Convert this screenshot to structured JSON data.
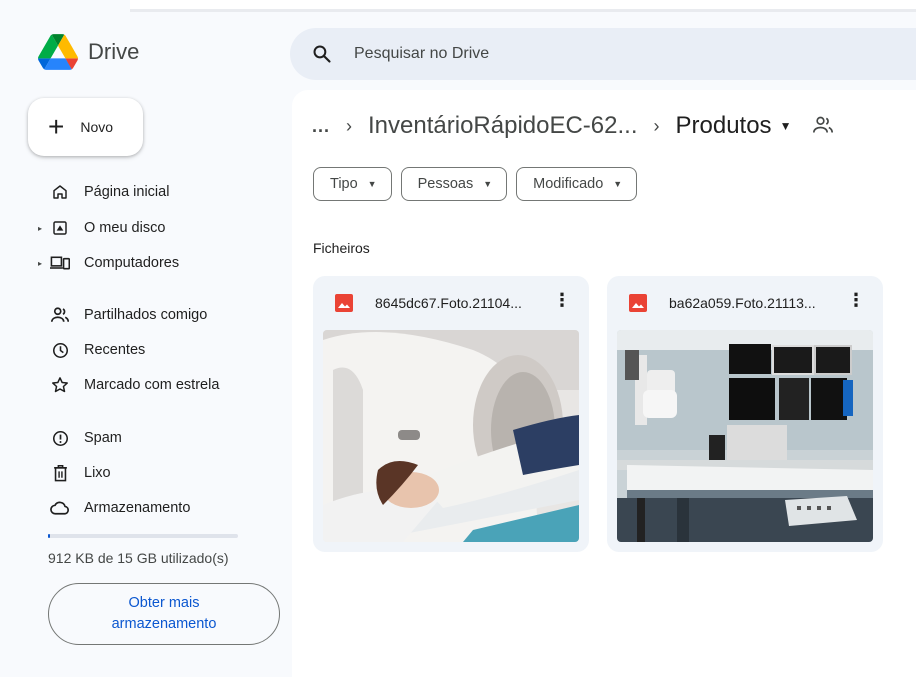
{
  "app": {
    "name": "Drive",
    "colors": {
      "accent": "#0b57d0",
      "background": "#f8fafd",
      "search_bg": "#e9eef6",
      "card_bg": "#f0f4f9",
      "pdf_red": "#ea4335"
    }
  },
  "sidebar": {
    "new_button": {
      "icon": "plus-icon",
      "label": "Novo"
    },
    "items": [
      {
        "label": "Página inicial",
        "icon": "home-icon",
        "expandable": false
      },
      {
        "label": "O meu disco",
        "icon": "my-drive-icon",
        "expandable": true
      },
      {
        "label": "Computadores",
        "icon": "computers-icon",
        "expandable": true
      },
      {
        "label": "Partilhados comigo",
        "icon": "shared-icon",
        "expandable": false
      },
      {
        "label": "Recentes",
        "icon": "clock-icon",
        "expandable": false
      },
      {
        "label": "Marcado com estrela",
        "icon": "star-icon",
        "expandable": false
      },
      {
        "label": "Spam",
        "icon": "spam-icon",
        "expandable": false
      },
      {
        "label": "Lixo",
        "icon": "trash-icon",
        "expandable": false
      },
      {
        "label": "Armazenamento",
        "icon": "cloud-icon",
        "expandable": false
      }
    ],
    "storage": {
      "used_text": "912 KB de 15 GB utilizado(s)",
      "used_fraction": 0.0001,
      "button_label": "Obter mais armazenamento"
    }
  },
  "search": {
    "placeholder": "Pesquisar no Drive",
    "icon": "search-icon"
  },
  "breadcrumb": {
    "more": "...",
    "separator": "›",
    "parent": "InventárioRápidoEC-62...",
    "current": "Produtos"
  },
  "filters": [
    {
      "label": "Tipo"
    },
    {
      "label": "Pessoas"
    },
    {
      "label": "Modificado"
    }
  ],
  "section": {
    "title": "Ficheiros"
  },
  "files": [
    {
      "name": "8645dc67.Foto.21104...",
      "icon": "image-file-icon"
    },
    {
      "name": "ba62a059.Foto.21113...",
      "icon": "image-file-icon"
    }
  ]
}
